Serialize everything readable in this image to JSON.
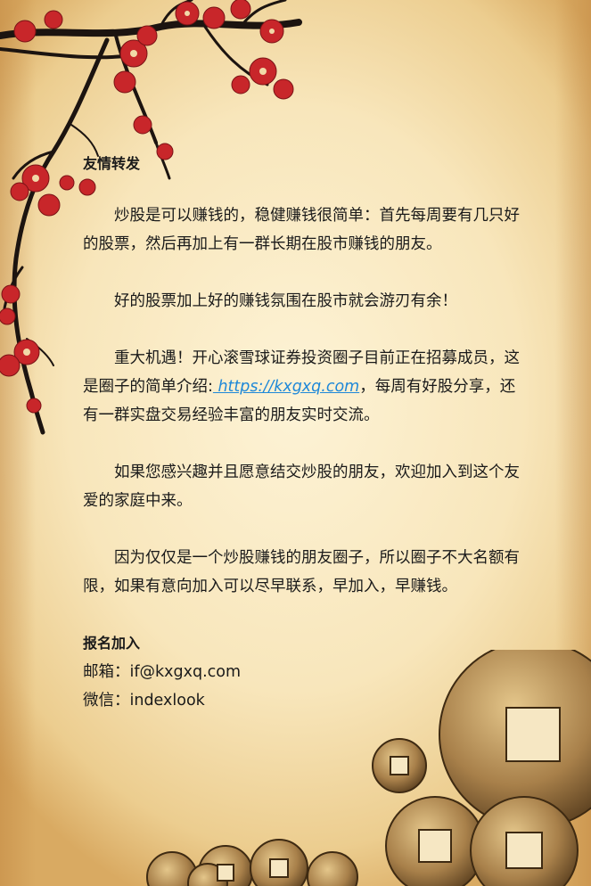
{
  "heading": "友情转发",
  "paragraphs": {
    "p1": "炒股是可以赚钱的，稳健赚钱很简单：首先每周要有几只好的股票，然后再加上有一群长期在股市赚钱的朋友。",
    "p2": "好的股票加上好的赚钱氛围在股市就会游刃有余！",
    "p3_before": "重大机遇！开心滚雪球证券投资圈子目前正在招募成员，这是圈子的简单介绍:",
    "p3_link": " https://kxgxq.com",
    "p3_after": "，每周有好股分享，还有一群实盘交易经验丰富的朋友实时交流。",
    "p4": "如果您感兴趣并且愿意结交炒股的朋友，欢迎加入到这个友爱的家庭中来。",
    "p5": "因为仅仅是一个炒股赚钱的朋友圈子，所以圈子不大名额有限，如果有意向加入可以尽早联系，早加入，早赚钱。"
  },
  "signup": {
    "title": "报名加入",
    "email": "邮箱：if@kxgxq.com",
    "wechat": "微信：indexlook"
  },
  "colors": {
    "link": "#1e88d8",
    "blossom": "#c8262a",
    "coin": "#b08850"
  }
}
